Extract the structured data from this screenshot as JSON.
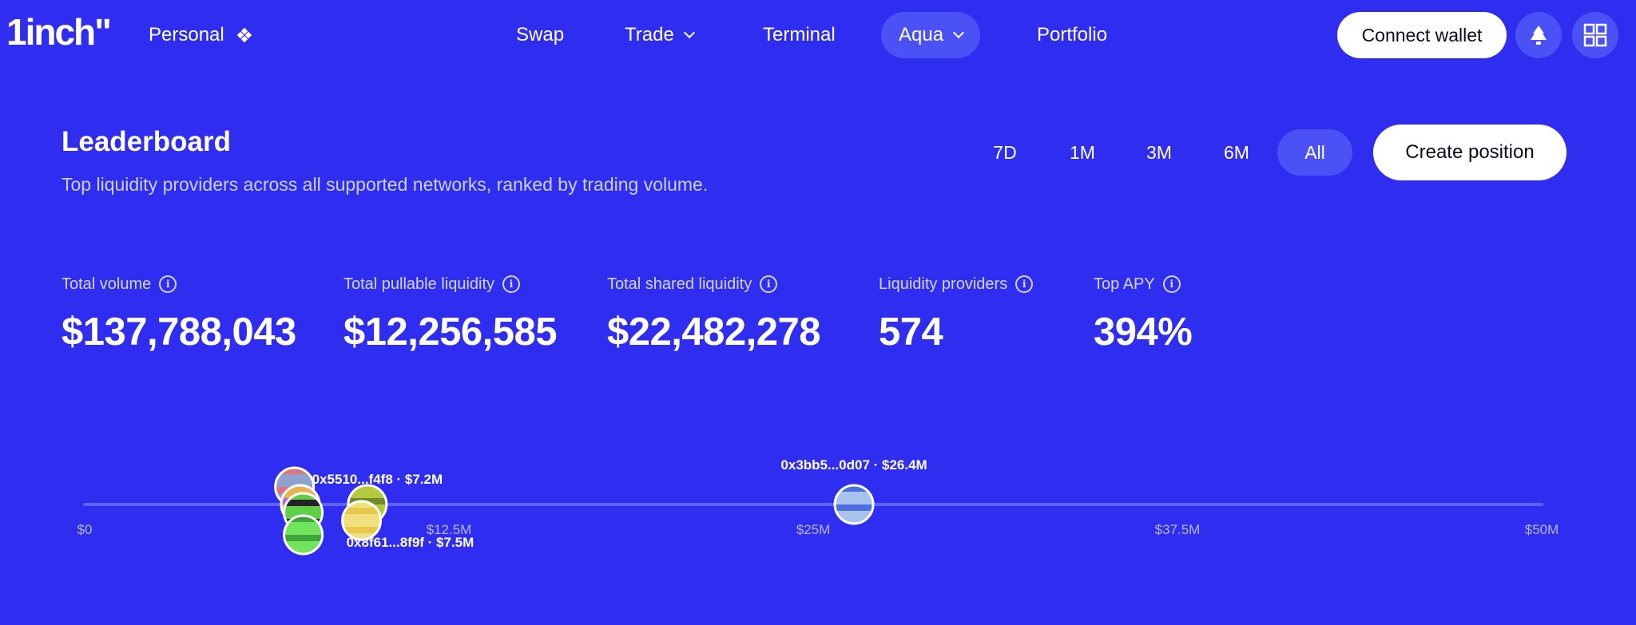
{
  "header": {
    "logo": "1inch\"",
    "account": "Personal",
    "nav": [
      {
        "label": "Swap",
        "has_menu": false,
        "active": false
      },
      {
        "label": "Trade",
        "has_menu": true,
        "active": false
      },
      {
        "label": "Terminal",
        "has_menu": false,
        "active": false
      },
      {
        "label": "Aqua",
        "has_menu": true,
        "active": true
      },
      {
        "label": "Portfolio",
        "has_menu": false,
        "active": false
      }
    ],
    "connect_wallet": "Connect wallet",
    "notification_icon": "bell-icon",
    "apps_icon": "grid-icon"
  },
  "leaderboard": {
    "title": "Leaderboard",
    "subtitle": "Top liquidity providers across all supported networks, ranked by trading volume.",
    "periods": [
      "7D",
      "1M",
      "3M",
      "6M",
      "All"
    ],
    "selected_period": "All",
    "create_position": "Create position"
  },
  "stats": [
    {
      "label": "Total volume",
      "value": "$137,788,043"
    },
    {
      "label": "Total pullable liquidity",
      "value": "$12,256,585"
    },
    {
      "label": "Total shared liquidity",
      "value": "$22,482,278"
    },
    {
      "label": "Liquidity providers",
      "value": "574"
    },
    {
      "label": "Top APY",
      "value": "394%"
    }
  ],
  "colors": {
    "background": "#2e2df0",
    "accent_pill": "#4a52f6",
    "axis_line": "#5a64ff"
  },
  "chart_data": {
    "type": "scatter",
    "xlim": [
      0,
      50000000
    ],
    "tick_labels": [
      "$0",
      "$12.5M",
      "$25M",
      "$37.5M",
      "$50M"
    ],
    "tick_values": [
      0,
      12500000,
      25000000,
      37500000,
      50000000
    ],
    "points": [
      {
        "label": "0x5510...f4f8 · $7.2M",
        "value": 7200000,
        "palette": [
          "#e0747c",
          "#8fa2ce"
        ]
      },
      {
        "label": "",
        "value": 7400000,
        "palette": [
          "#b16bd3",
          "#e8b152"
        ]
      },
      {
        "label": "",
        "value": 7500000,
        "palette": [
          "#25202c",
          "#5fd045"
        ]
      },
      {
        "label": "0x8f61...8f9f · $7.5M",
        "value": 7500000,
        "palette": [
          "#3ea43c",
          "#72e35c"
        ]
      },
      {
        "label": "",
        "value": 9700000,
        "palette": [
          "#6e8b2c",
          "#b6c83b"
        ]
      },
      {
        "label": "",
        "value": 9500000,
        "palette": [
          "#e7c84a",
          "#f1e07e"
        ]
      },
      {
        "label": "0x3bb5...0d07 · $26.4M",
        "value": 26400000,
        "palette": [
          "#4b6fe0",
          "#a9c3ef"
        ]
      }
    ]
  }
}
